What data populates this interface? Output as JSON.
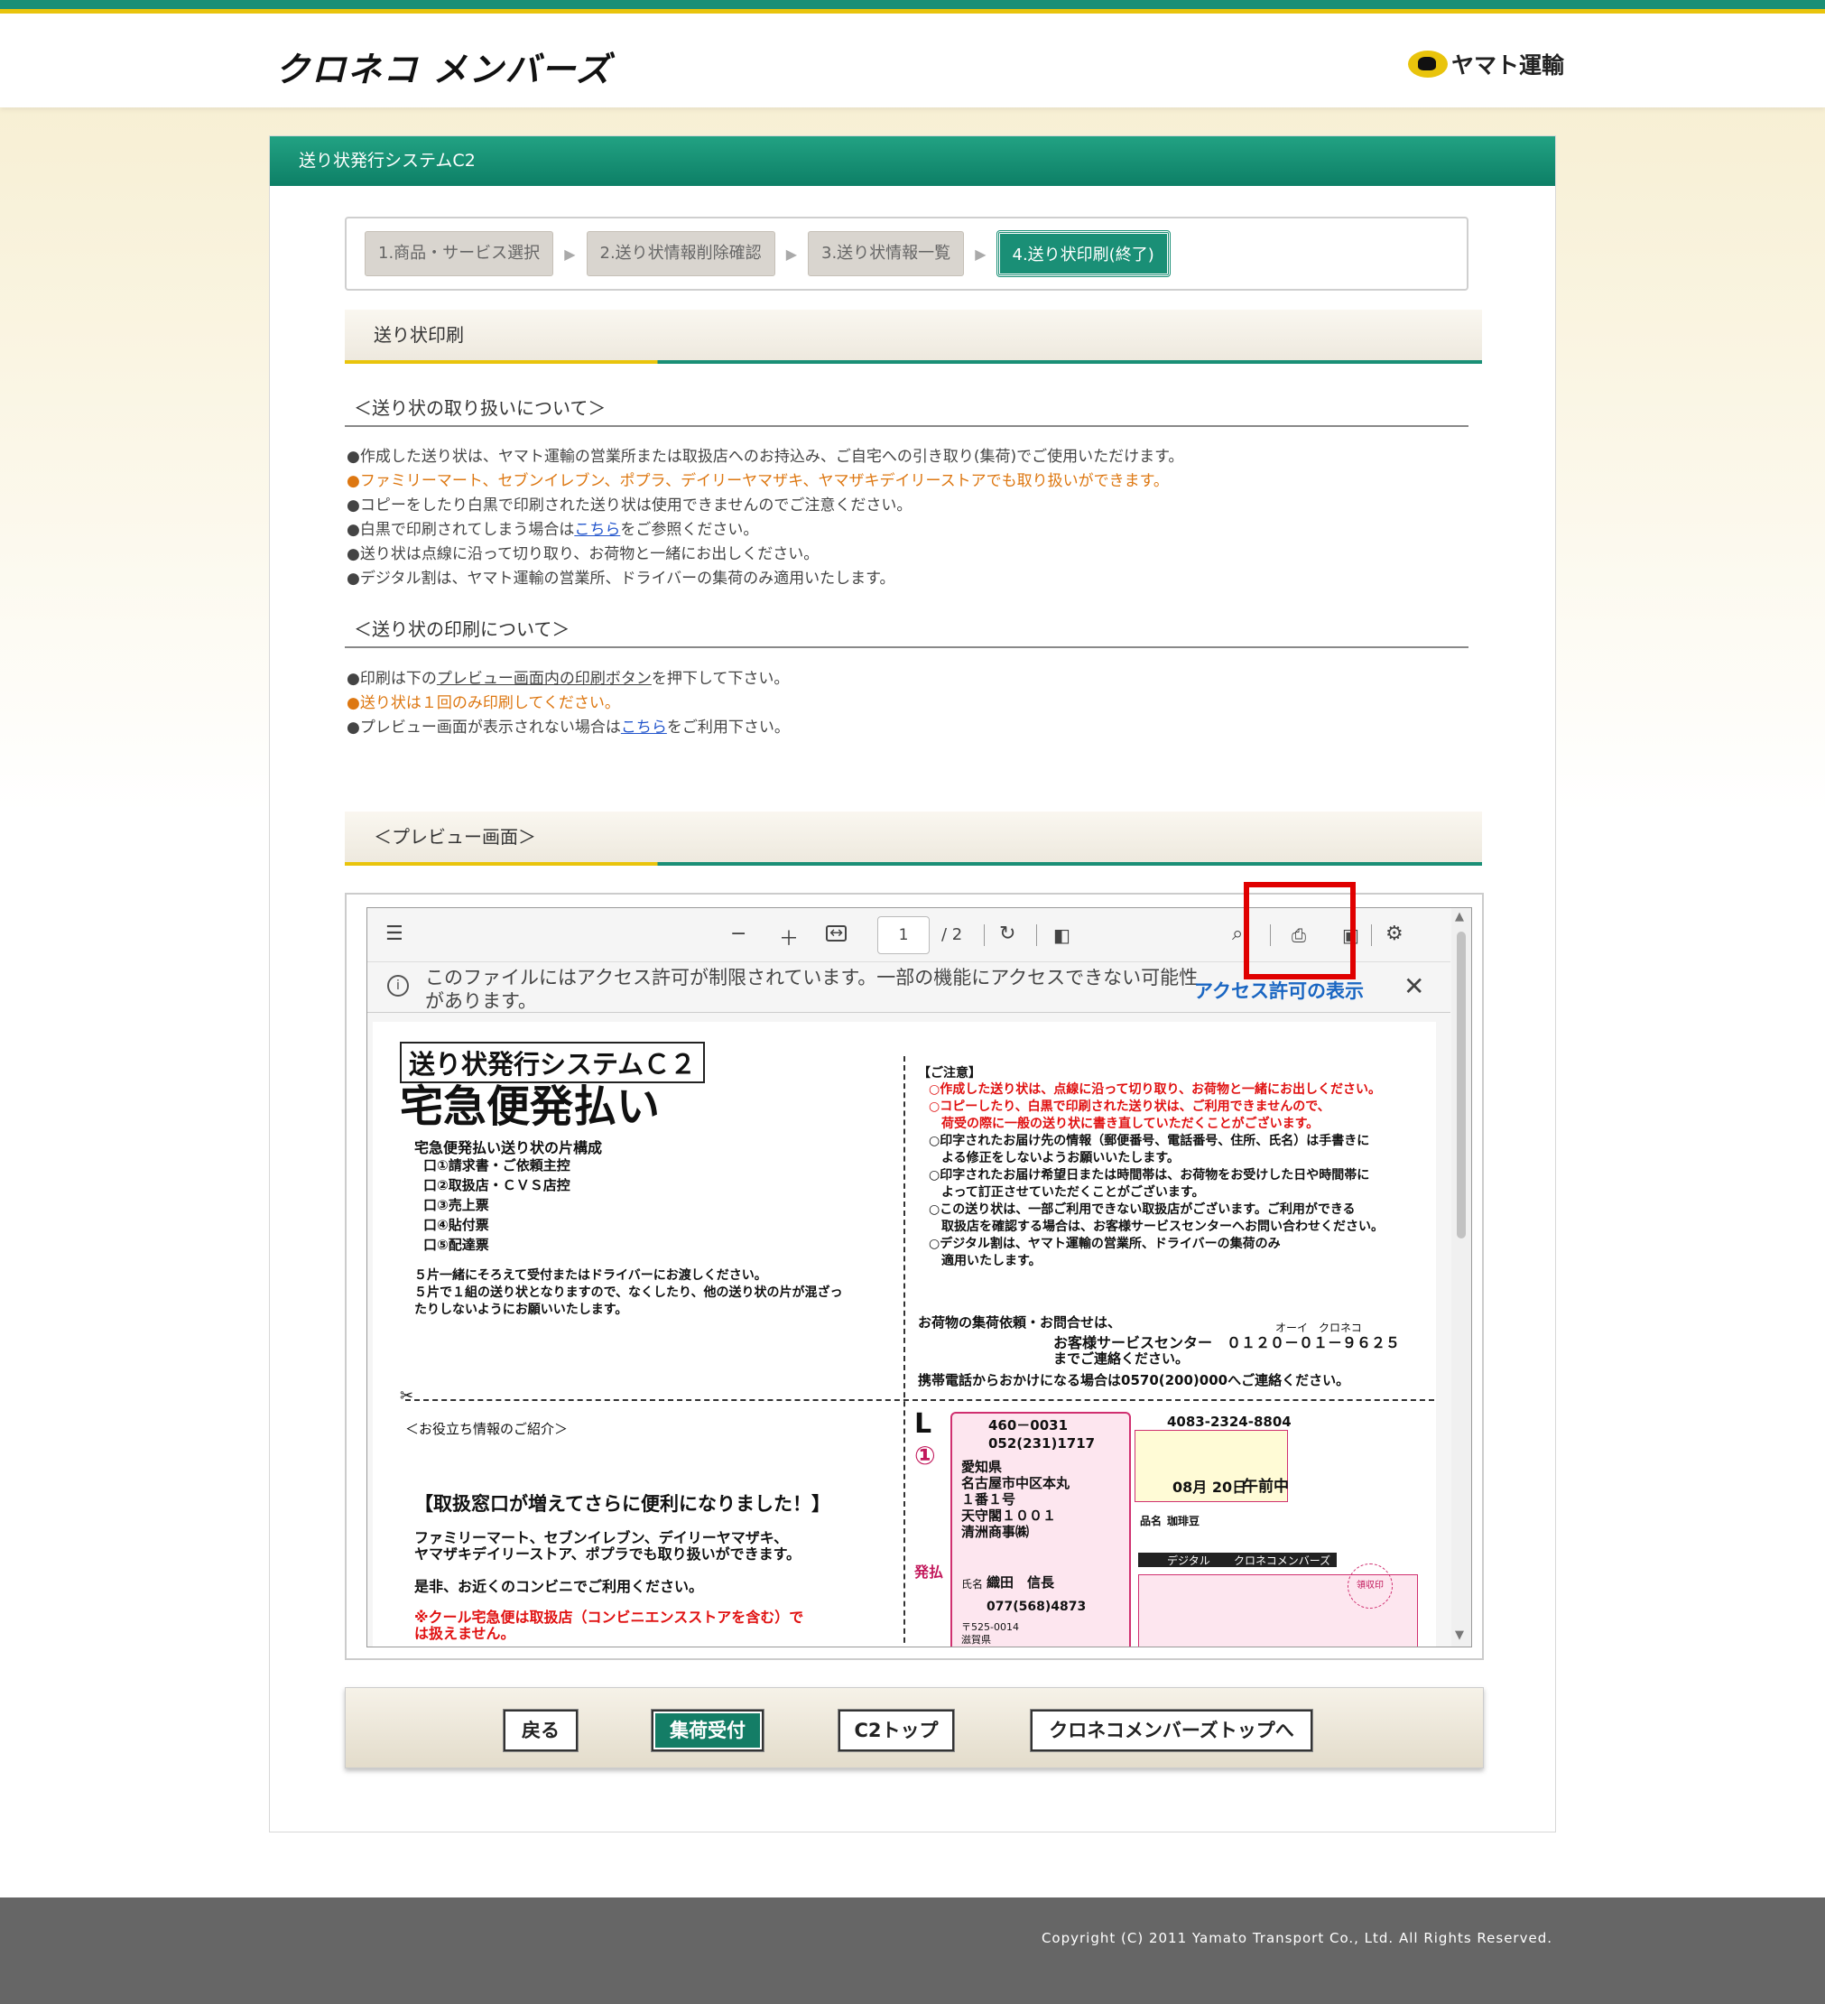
{
  "header": {
    "brand": "クロネコ メンバーズ",
    "yamato": "ヤマト運輸"
  },
  "panel": {
    "title": "送り状発行システムC2"
  },
  "steps": [
    {
      "label": "1.商品・サービス選択"
    },
    {
      "label": "2.送り状情報削除確認"
    },
    {
      "label": "3.送り状情報一覧"
    },
    {
      "label": "4.送り状印刷(終了)"
    }
  ],
  "section1": {
    "title": "送り状印刷"
  },
  "handling": {
    "title": "＜送り状の取り扱いについて＞",
    "items": [
      "●作成した送り状は、ヤマト運輸の営業所または取扱店へのお持込み、ご自宅への引き取り(集荷)でご使用いただけます。",
      "●ファミリーマート、セブンイレブン、ポプラ、デイリーヤマザキ、ヤマザキデイリーストアでも取り扱いができます。",
      "●コピーをしたり白黒で印刷された送り状は使用できませんのでご注意ください。",
      "●白黒で印刷されてしまう場合は",
      "こちら",
      "をご参照ください。",
      "●送り状は点線に沿って切り取り、お荷物と一緒にお出しください。",
      "●デジタル割は、ヤマト運輸の営業所、ドライバーの集荷のみ適用いたします。"
    ]
  },
  "printing": {
    "title": "＜送り状の印刷について＞",
    "items": [
      "●印刷は下の",
      "プレビュー画面内の印刷ボタン",
      "を押下して下さい。",
      "●送り状は１回のみ印刷してください。",
      "●プレビュー画面が表示されない場合は",
      "こちら",
      "をご利用下さい。"
    ]
  },
  "preview": {
    "title": "＜プレビュー画面＞"
  },
  "viewer": {
    "page": "1",
    "page_total": "/ 2",
    "notice": "このファイルにはアクセス許可が制限されています。一部の機能にアクセスできない可能性があります。",
    "notice_link": "アクセス許可の表示"
  },
  "doc": {
    "system": "送り状発行システムＣ２",
    "title": "宅急便発払い",
    "parts_title": "宅急便発払い送り状の片構成",
    "parts": [
      "口①請求書・ご依頼主控",
      "口②取扱店・ＣＶＳ店控",
      "口③売上票",
      "口④貼付票",
      "口⑤配達票"
    ],
    "note1": "５片一緒にそろえて受付またはドライバーにお渡しください。",
    "note2": "５片で１組の送り状となりますので、なくしたり、他の送り状の片が混ざっ",
    "note3": "たりしないようにお願いいたします。",
    "caution_title": "【ご注意】",
    "cautions_red": [
      "○作成した送り状は、点線に沿って切り取り、お荷物と一緒にお出しください。",
      "○コピーしたり、白黒で印刷された送り状は、ご利用できませんので、",
      "　荷受の際に一般の送り状に書き直していただくことがございます。"
    ],
    "cautions": [
      "○印字されたお届け先の情報（郵便番号、電話番号、住所、氏名）は手書きに",
      "　よる修正をしないようお願いいたします。",
      "○印字されたお届け希望日または時間帯は、お荷物をお受けした日や時間帯に",
      "　よって訂正させていただくことがございます。",
      "○この送り状は、一部ご利用できない取扱店がございます。ご利用ができる",
      "　取扱店を確認する場合は、お客様サービスセンターへお問い合わせください。",
      "○デジタル割は、ヤマト運輸の営業所、ドライバーの集荷のみ",
      "　適用いたします。"
    ],
    "contact1": "お荷物の集荷依頼・お問合せは、",
    "contact_kana": "オーイ　クロネコ",
    "contact2": "お客様サービスセンター　０１２０－０１－９６２５",
    "contact3": "までご連絡ください。",
    "contact4": "携帯電話からおかけになる場合は0570(200)000へご連絡ください。",
    "info_title": "＜お役立ち情報のご紹介＞",
    "promo_title": "【取扱窓口が増えてさらに便利になりました！】",
    "promo1": "ファミリーマート、セブンイレブン、デイリーヤマザキ、",
    "promo2": "ヤマザキデイリーストア、ポプラでも取り扱いができます。",
    "promo3": "是非、お近くのコンビニでご利用ください。",
    "promo_red1": "※クール宅急便は取扱店（コンビニエンスストアを含む）で",
    "promo_red2": "は扱えません。",
    "label": {
      "size": "L",
      "num": "①",
      "postal": "460－0031",
      "tel": "052(231)1717",
      "addr1": "愛知県",
      "addr2": "名古屋市中区本丸",
      "addr3": "１番１号",
      "addr4": "天守閣１００１",
      "company": "清洲商事㈱",
      "slip": "4083-2324-8804",
      "date": "08月 20日",
      "time": "午前中",
      "item_label": "品名",
      "item": "珈琲豆",
      "digital": "デジタル",
      "kuroneko": "クロネコメンバーズ",
      "sender_label": "氏名",
      "sender": "織田　信長",
      "sender_tel": "077(568)4873",
      "sender_postal": "〒525-0014",
      "sender_addr": "滋賀県",
      "hatsu": "発払",
      "stamp": "領収印"
    }
  },
  "buttons": {
    "back": "戻る",
    "pickup": "集荷受付",
    "c2top": "C2トップ",
    "memtop": "クロネコメンバーズトップへ"
  },
  "footer": {
    "copyright": "Copyright (C) 2011 Yamato Transport Co., Ltd. All Rights Reserved."
  }
}
